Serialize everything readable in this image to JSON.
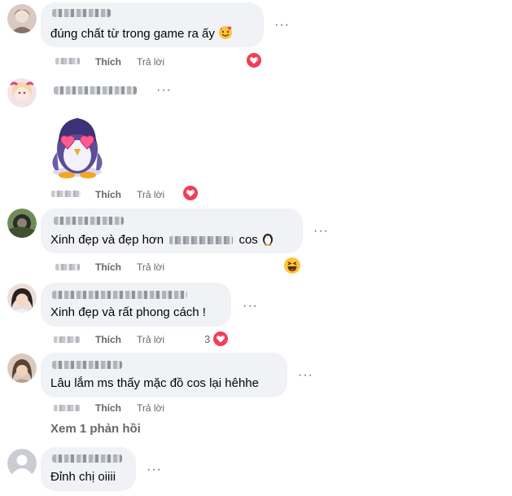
{
  "comments": [
    {
      "text": "đúng chất từ trong game ra ấy",
      "emoji_icon": "smiling-face-with-hearts-emoji",
      "like_label": "Thích",
      "reply_label": "Trả lời",
      "reaction": "love"
    },
    {
      "sticker": "penguin-heart-eyes-sticker",
      "like_label": "Thích",
      "reply_label": "Trả lời",
      "reaction": "love"
    },
    {
      "text_before": "Xinh đẹp và đẹp hơn",
      "text_after": "cos",
      "emoji_icon": "penguin-emoji",
      "like_label": "Thích",
      "reply_label": "Trả lời",
      "reaction": "haha"
    },
    {
      "text": "Xinh đẹp và rất phong cách !",
      "like_label": "Thích",
      "reply_label": "Trả lời",
      "reaction": "love",
      "reaction_count": "3"
    },
    {
      "text": "Lâu lắm ms thấy mặc đồ cos lại hêhhe",
      "like_label": "Thích",
      "reply_label": "Trả lời"
    },
    {
      "text": "Đỉnh chị oiiii"
    }
  ],
  "view_replies_label": "Xem 1 phản hồi",
  "more_glyph": "···",
  "colors": {
    "bubble": "#f0f2f5",
    "secondary_text": "#65676b",
    "love": "#f33e58",
    "haha": "#fcc53c"
  }
}
